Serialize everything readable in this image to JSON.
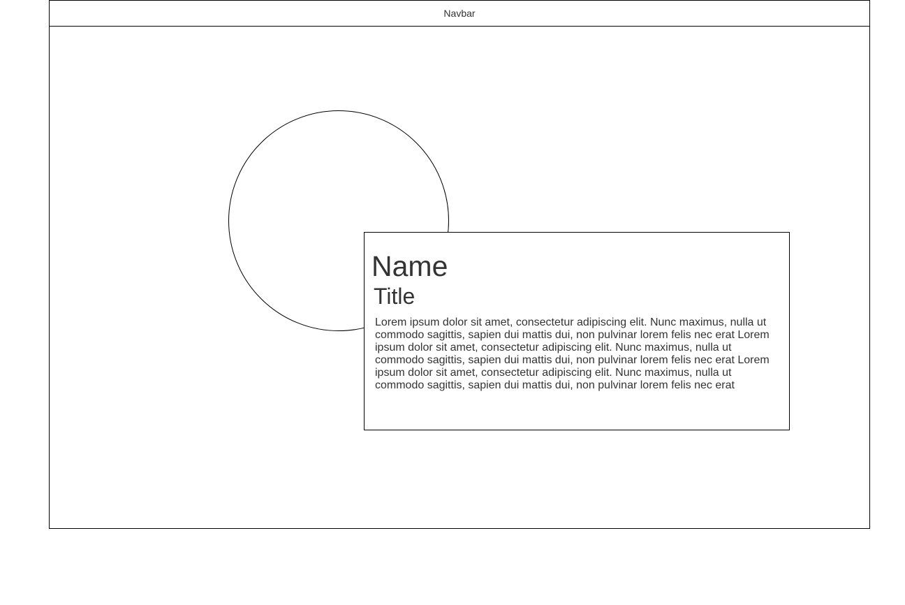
{
  "navbar": {
    "label": "Navbar"
  },
  "profile": {
    "name": "Name",
    "title": "Title",
    "bio": "Lorem ipsum dolor sit amet, consectetur adipiscing elit. Nunc maximus, nulla ut commodo sagittis, sapien dui mattis dui, non pulvinar lorem felis nec erat Lorem ipsum dolor sit amet, consectetur adipiscing elit. Nunc maximus, nulla ut commodo sagittis, sapien dui mattis dui, non pulvinar lorem felis nec erat Lorem ipsum dolor sit amet, consectetur adipiscing elit. Nunc maximus, nulla ut commodo sagittis, sapien dui mattis dui, non pulvinar lorem felis nec erat"
  },
  "colors": {
    "text": "#333333",
    "border": "#000000",
    "background": "#ffffff"
  }
}
